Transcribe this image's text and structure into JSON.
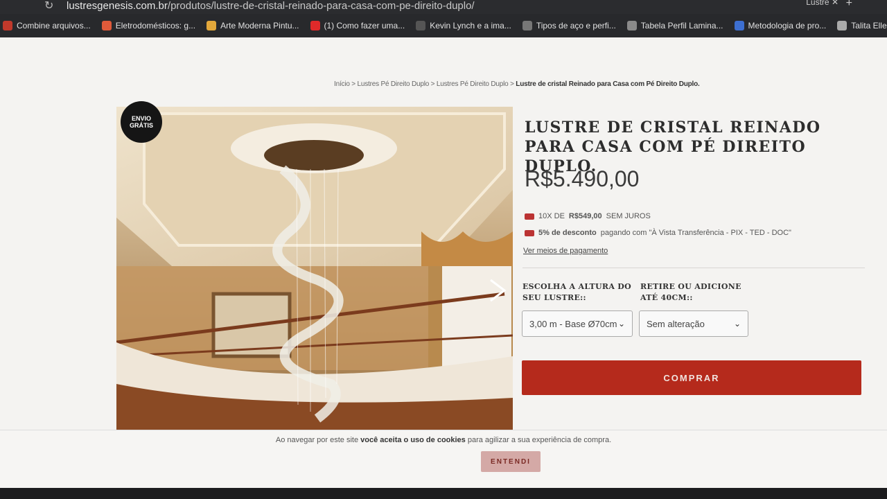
{
  "browser": {
    "url_host": "lustresgenesis.com.br",
    "url_path": "/produtos/lustre-de-cristal-reinado-para-casa-com-pe-direito-duplo/",
    "tab_title": "Lustre"
  },
  "bookmarks": [
    {
      "label": "Combine arquivos...",
      "color": "#c0392b"
    },
    {
      "label": "Eletrodomésticos: g...",
      "color": "#e05a3a"
    },
    {
      "label": "Arte Moderna Pintu...",
      "color": "#e3a83b"
    },
    {
      "label": "(1) Como fazer uma...",
      "color": "#e02a2a"
    },
    {
      "label": "Kevin Lynch e a ima...",
      "color": "#555555"
    },
    {
      "label": "Tipos de aço e perfi...",
      "color": "#777777"
    },
    {
      "label": "Tabela Perfil Lamina...",
      "color": "#8a8a8a"
    },
    {
      "label": "Metodologia de pro...",
      "color": "#3d6fd1"
    },
    {
      "label": "Talita Ellen Lullo De...",
      "color": "#aaaaaa"
    }
  ],
  "breadcrumb": {
    "home": "Início",
    "cat1": "Lustres Pé Direito Duplo",
    "cat2": "Lustres Pé Direito Duplo",
    "current": "Lustre de cristal Reinado para Casa com Pé Direito Duplo."
  },
  "product": {
    "badge": "ENVIO GRÁTIS",
    "title": "LUSTRE DE CRISTAL REINADO PARA CASA COM PÉ DIREITO DUPLO.",
    "price": "R$5.490,00",
    "installments_prefix": "10X DE",
    "installments_value": "R$549,00",
    "installments_suffix": "SEM JUROS",
    "discount_bold": "5% de desconto",
    "discount_rest": "pagando com \"À Vista Transferência - PIX - TED - DOC\"",
    "payment_link": "Ver meios de pagamento",
    "height_label": "ESCOLHA A ALTURA DO SEU LUSTRE::",
    "height_value": "3,00 m - Base Ø70cm",
    "adjust_label": "RETIRE OU ADICIONE ATÉ 40CM::",
    "adjust_value": "Sem alteração",
    "buy_label": "COMPRAR"
  },
  "cookie": {
    "text_pre": "Ao navegar por este site",
    "text_bold": "você aceita o uso de cookies",
    "text_post": "para agilizar a sua experiência de compra.",
    "button": "ENTENDI"
  },
  "colors": {
    "buy_button": "#b52a1c",
    "cookie_button": "#d4a9a6"
  }
}
